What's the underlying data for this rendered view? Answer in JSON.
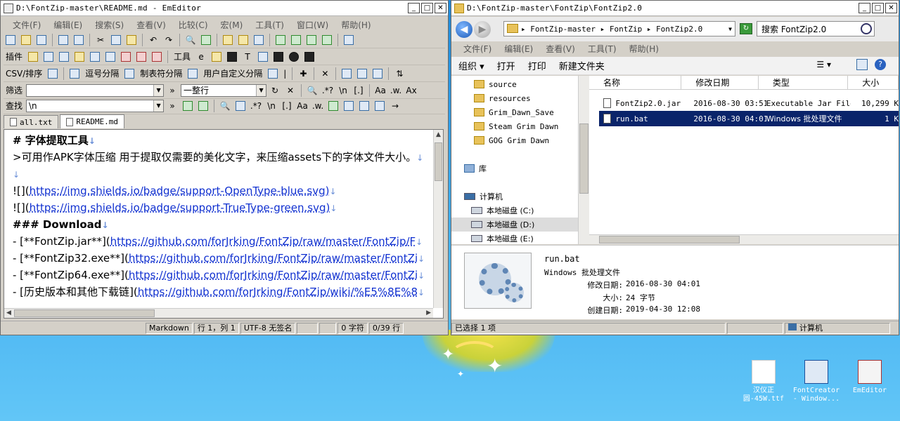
{
  "editor": {
    "title": "D:\\FontZip-master\\README.md - EmEditor",
    "menu": [
      "文件(F)",
      "编辑(E)",
      "搜索(S)",
      "查看(V)",
      "比较(C)",
      "宏(M)",
      "工具(T)",
      "窗口(W)",
      "帮助(H)"
    ],
    "toolbar2": {
      "plugins_label": "插件",
      "tools_label": "工具"
    },
    "csvbar": {
      "sort_label": "CSV/排序",
      "comma_label": "逗号分隔",
      "tab_label": "制表符分隔",
      "custom_label": "用户自定义分隔"
    },
    "filterbar": {
      "label": "筛选",
      "mode": "一整行"
    },
    "findbar": {
      "label": "查找",
      "value": "\\n"
    },
    "tabs": [
      "all.txt",
      "README.md"
    ],
    "lines": [
      {
        "pre": "# 字体提取工具",
        "url": "",
        "post": ""
      },
      {
        "pre": ">可用作APK字体压缩 用于提取仅需要的美化文字，来压缩assets下的字体文件大小。",
        "url": "",
        "post": ""
      },
      {
        "pre": "",
        "url": "",
        "post": ""
      },
      {
        "pre": "![](",
        "url": "https://img.shields.io/badge/support-OpenType-blue.svg",
        "post": ")"
      },
      {
        "pre": "![](",
        "url": "https://img.shields.io/badge/support-TrueType-green.svg",
        "post": ")"
      },
      {
        "pre": "### Download",
        "url": "",
        "post": ""
      },
      {
        "pre": "- [**FontZip.jar**](",
        "url": "https://github.com/forJrking/FontZip/raw/master/FontZip/F",
        "post": ""
      },
      {
        "pre": "- [**FontZip32.exe**](",
        "url": "https://github.com/forJrking/FontZip/raw/master/FontZi",
        "post": ""
      },
      {
        "pre": "- [**FontZip64.exe**](",
        "url": "https://github.com/forJrking/FontZip/raw/master/FontZi",
        "post": ""
      },
      {
        "pre": "- [历史版本和其他下载链](",
        "url": "https://github.com/forJrking/FontZip/wiki/%E5%8E%8",
        "post": ""
      }
    ],
    "status": [
      "Markdown",
      "行 1，列 1",
      "UTF-8 无签名",
      "0 字符",
      "0/39 行"
    ]
  },
  "explorer": {
    "title": "D:\\FontZip-master\\FontZip\\FontZip2.0",
    "address": "▸ FontZip-master ▸ FontZip ▸ FontZip2.0",
    "search_placeholder": "搜索 FontZip2.0",
    "menu": [
      "文件(F)",
      "编辑(E)",
      "查看(V)",
      "工具(T)",
      "帮助(H)"
    ],
    "commands": [
      "组织 ▾",
      "打开",
      "打印",
      "新建文件夹"
    ],
    "nav": [
      {
        "label": "source",
        "kind": "folder"
      },
      {
        "label": "resources",
        "kind": "folder"
      },
      {
        "label": "Grim_Dawn_Save",
        "kind": "folder"
      },
      {
        "label": "Steam Grim Dawn",
        "kind": "folder"
      },
      {
        "label": "GOG Grim Dawn",
        "kind": "folder"
      },
      {
        "label": "库",
        "kind": "library"
      },
      {
        "label": "计算机",
        "kind": "computer"
      },
      {
        "label": "本地磁盘 (C:)",
        "kind": "drive"
      },
      {
        "label": "本地磁盘 (D:)",
        "kind": "drive"
      },
      {
        "label": "本地磁盘 (E:)",
        "kind": "drive"
      }
    ],
    "columns": [
      "名称",
      "修改日期",
      "类型",
      "大小"
    ],
    "files": [
      {
        "name": "FontZip2.0.jar",
        "date": "2016-08-30 03:51",
        "type": "Executable Jar File",
        "size": "10,299 K"
      },
      {
        "name": "run.bat",
        "date": "2016-08-30 04:01",
        "type": "Windows 批处理文件",
        "size": "1 K"
      }
    ],
    "details": {
      "name": "run.bat",
      "type": "Windows 批处理文件",
      "modified_label": "修改日期:",
      "modified": "2016-08-30 04:01",
      "size_label": "大小:",
      "size": "24 字节",
      "created_label": "创建日期:",
      "created": "2019-04-30 12:08"
    },
    "status_left": "已选择 1 项",
    "status_right": "计算机"
  },
  "desktop_icons": [
    "汉仪正圆-45W.ttf",
    "FontCreator - Window...",
    "EmEditor"
  ]
}
